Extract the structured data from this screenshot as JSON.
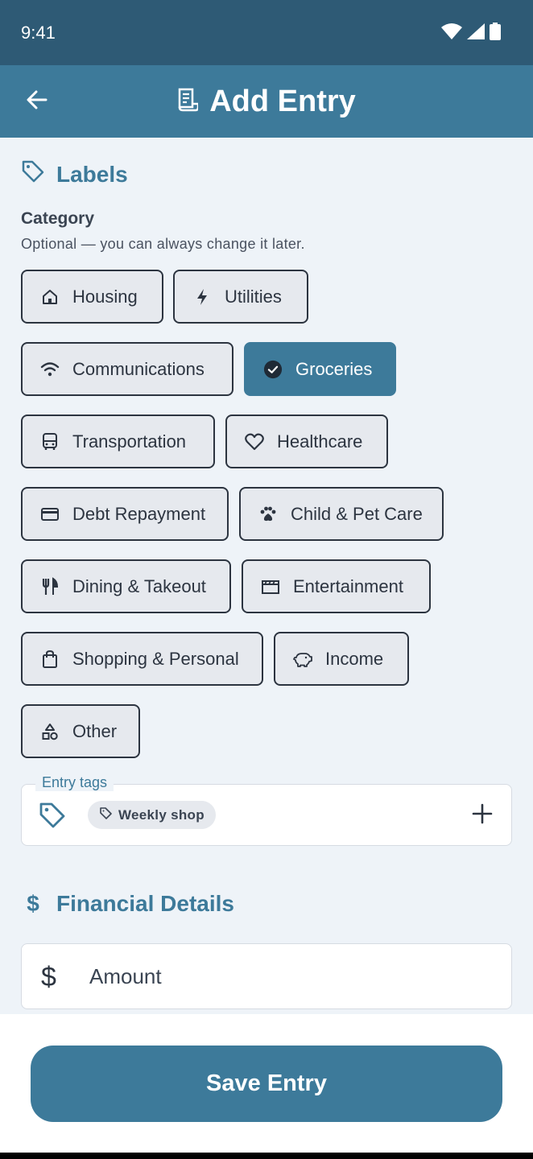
{
  "status_bar": {
    "time": "9:41"
  },
  "app_bar": {
    "title": "Add Entry"
  },
  "labels_section": {
    "heading": "Labels",
    "category_label": "Category",
    "category_help": "Optional — you can always change it later.",
    "categories": [
      {
        "label": "Housing",
        "icon": "home-icon",
        "selected": false
      },
      {
        "label": "Utilities",
        "icon": "bolt-icon",
        "selected": false
      },
      {
        "label": "Communications",
        "icon": "wifi-icon",
        "selected": false
      },
      {
        "label": "Groceries",
        "icon": "check-circle-icon",
        "selected": true
      },
      {
        "label": "Transportation",
        "icon": "bus-icon",
        "selected": false
      },
      {
        "label": "Healthcare",
        "icon": "heart-icon",
        "selected": false
      },
      {
        "label": "Debt Repayment",
        "icon": "credit-card-icon",
        "selected": false
      },
      {
        "label": "Child & Pet Care",
        "icon": "paw-icon",
        "selected": false
      },
      {
        "label": "Dining & Takeout",
        "icon": "fork-knife-icon",
        "selected": false
      },
      {
        "label": "Entertainment",
        "icon": "clapperboard-icon",
        "selected": false
      },
      {
        "label": "Shopping & Personal",
        "icon": "shopping-bag-icon",
        "selected": false
      },
      {
        "label": "Income",
        "icon": "piggy-bank-icon",
        "selected": false
      },
      {
        "label": "Other",
        "icon": "shapes-icon",
        "selected": false
      }
    ],
    "entry_tags_label": "Entry tags",
    "tags": [
      {
        "label": "Weekly shop"
      }
    ]
  },
  "financial_section": {
    "heading": "Financial Details",
    "amount_placeholder": "Amount"
  },
  "footer": {
    "save_label": "Save Entry"
  },
  "colors": {
    "accent": "#3d7a9a",
    "status_bar": "#2e5a75",
    "background": "#eef3f8",
    "chip_bg": "#e6e9ee"
  }
}
